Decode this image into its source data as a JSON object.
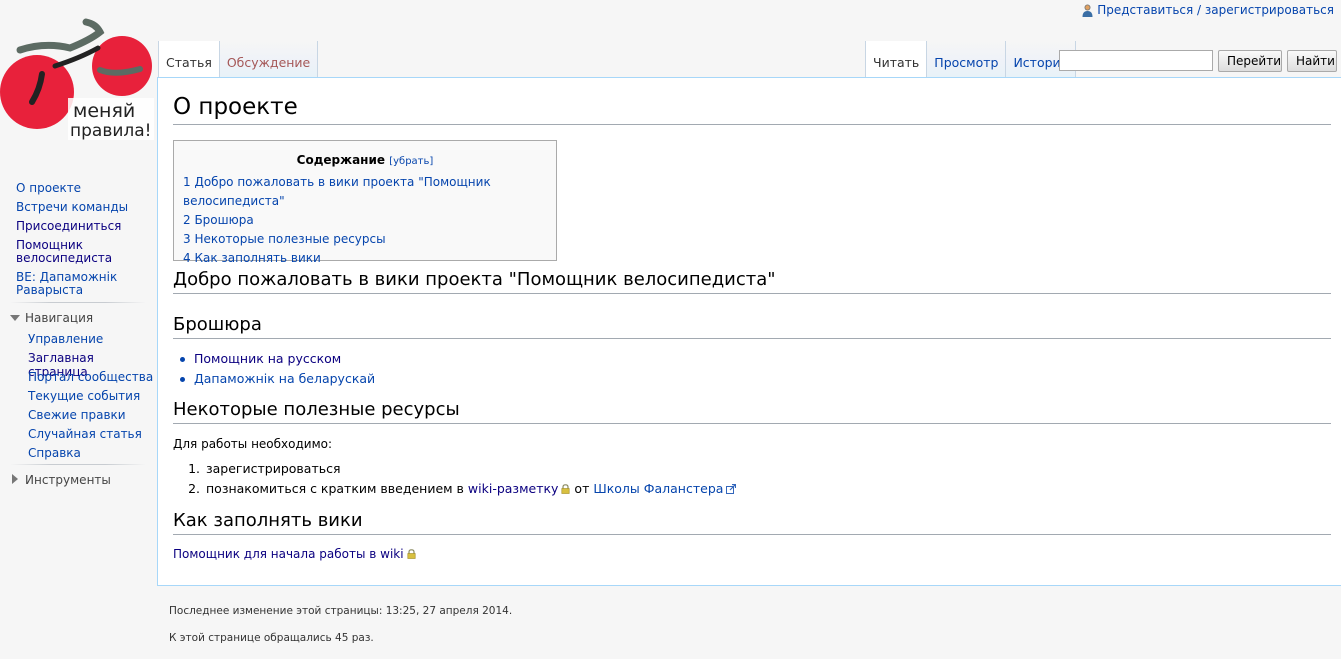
{
  "personal": {
    "login_link": "Представиться / зарегистрироваться"
  },
  "logo": {
    "alt": "меняй правила!",
    "line1": "меняй",
    "line2": "правила!"
  },
  "tabs_left": [
    {
      "label": "Статья"
    },
    {
      "label": "Обсуждение"
    }
  ],
  "tabs_right": [
    {
      "label": "Читать"
    },
    {
      "label": "Просмотр"
    },
    {
      "label": "История"
    }
  ],
  "search": {
    "value": "",
    "go_label": "Перейти",
    "search_label": "Найти"
  },
  "sidebar": {
    "links": [
      "О проекте",
      "Встречи команды",
      "Присоединиться",
      "Помощник велосипедиста",
      "BE: Дапаможнік Раварыста"
    ],
    "navigation": {
      "title": "Навигация",
      "items": [
        "Управление",
        "Заглавная страница",
        "Портал сообщества",
        "Текущие события",
        "Свежие правки",
        "Случайная статья",
        "Справка"
      ]
    },
    "tools": {
      "title": "Инструменты"
    }
  },
  "page": {
    "title": "О проекте",
    "toc": {
      "title": "Содержание",
      "toggle": "[убрать]",
      "items": [
        "1 Добро пожаловать в вики проекта \"Помощник велосипедиста\"",
        "2 Брошюра",
        "3 Некоторые полезные ресурсы",
        "4 Как заполнять вики"
      ]
    },
    "sections": {
      "welcome": {
        "title": "Добро пожаловать в вики проекта \"Помощник велосипедиста\""
      },
      "brochure": {
        "title": "Брошюра",
        "items": [
          "Помощник на русском",
          "Дапаможнік на беларускай"
        ]
      },
      "resources": {
        "title": "Некоторые полезные ресурсы",
        "intro": "Для работы необходимо:",
        "step1": "зарегистрироваться",
        "step2_prefix": "познакомиться с кратким введением в",
        "step2_link1": "wiki-разметку",
        "step2_mid": "от",
        "step2_link2": "Школы Фаланстера"
      },
      "howto": {
        "title": "Как заполнять вики",
        "link": "Помощник для начала работы в wiki"
      }
    }
  },
  "footer": {
    "lastmod": "Последнее изменение этой страницы: 13:25, 27 апреля 2014.",
    "views": "К этой странице обращались 45 раз."
  }
}
